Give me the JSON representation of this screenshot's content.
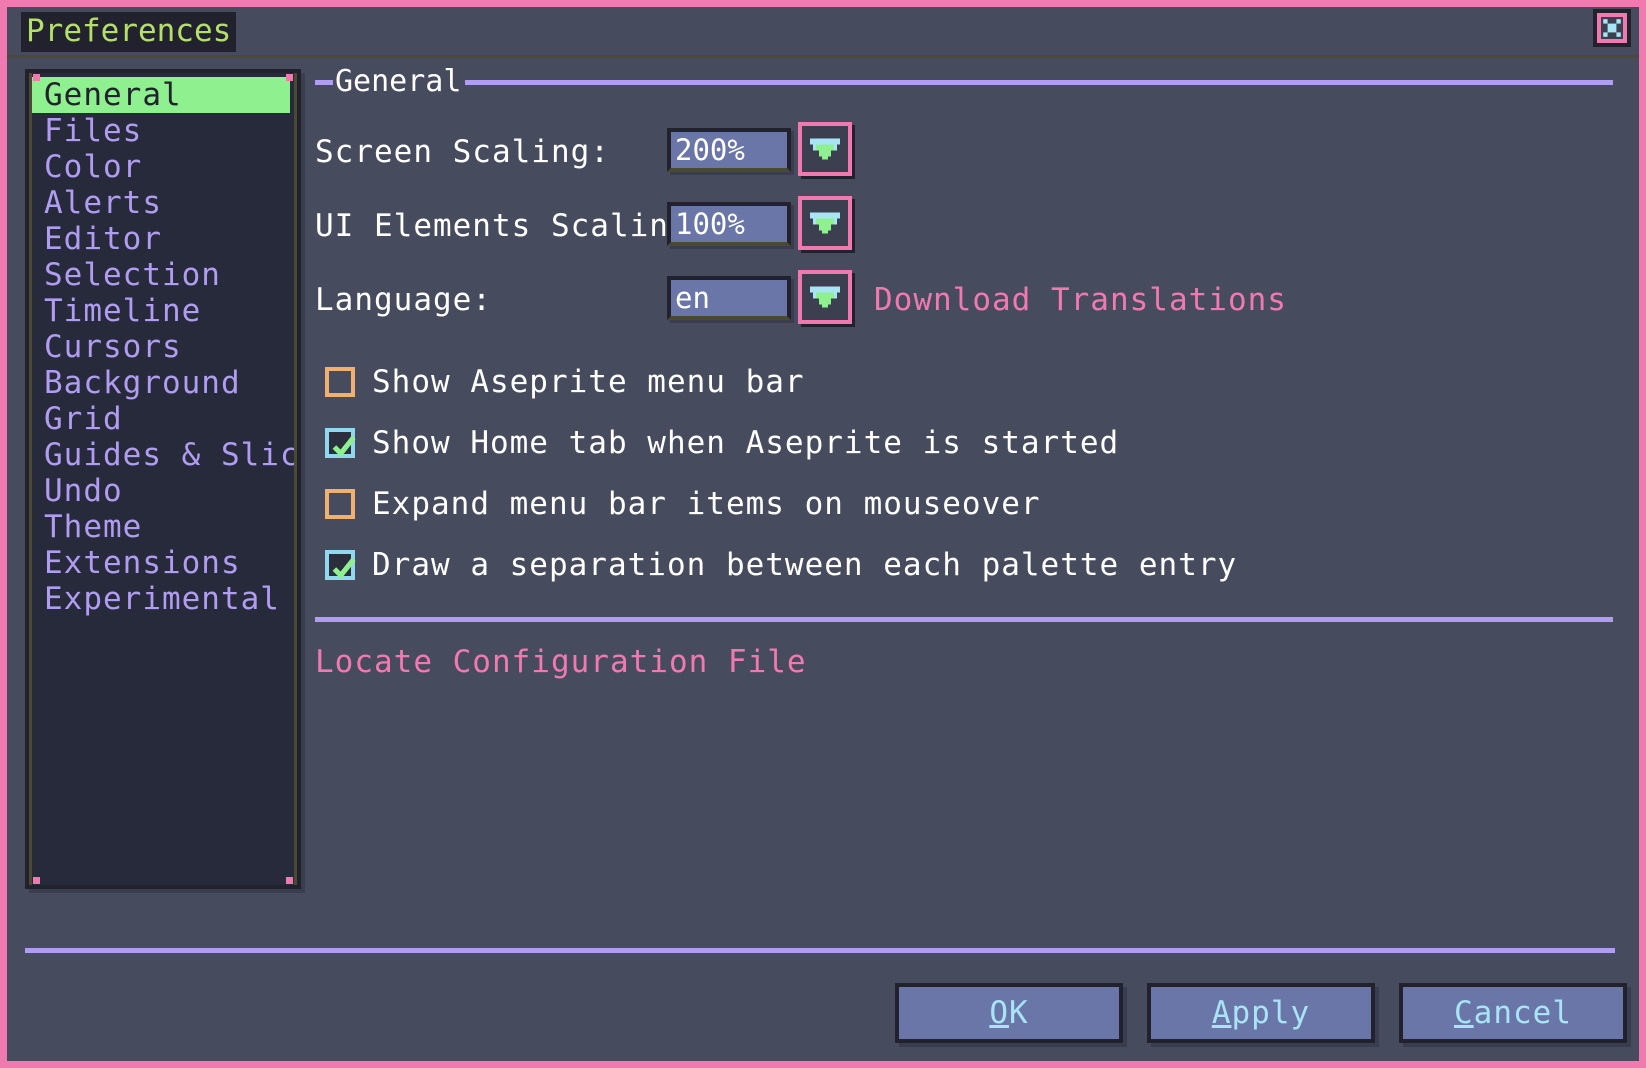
{
  "window": {
    "title": "Preferences",
    "close_icon": "close-x-icon"
  },
  "colors": {
    "window_border": "#f07ab0",
    "window_bg": "#474b5e",
    "panel_dark": "#272a3a",
    "selected_item_bg": "#8ef08e",
    "list_item_text": "#b09cf0",
    "link_pink": "#f07ab0",
    "rule_purple": "#b09cf0",
    "title_green": "#b4e06a",
    "checkbox_off": "#f0b070",
    "checkbox_on": "#90d8f0",
    "checkmark_green": "#8ef08e",
    "field_bg": "#6a76a8",
    "button_text": "#a8e4f4"
  },
  "sidebar": {
    "items": [
      {
        "label": "General",
        "selected": true
      },
      {
        "label": "Files",
        "selected": false
      },
      {
        "label": "Color",
        "selected": false
      },
      {
        "label": "Alerts",
        "selected": false
      },
      {
        "label": "Editor",
        "selected": false
      },
      {
        "label": "Selection",
        "selected": false
      },
      {
        "label": "Timeline",
        "selected": false
      },
      {
        "label": "Cursors",
        "selected": false
      },
      {
        "label": "Background",
        "selected": false
      },
      {
        "label": "Grid",
        "selected": false
      },
      {
        "label": "Guides & Slices",
        "selected": false
      },
      {
        "label": "Undo",
        "selected": false
      },
      {
        "label": "Theme",
        "selected": false
      },
      {
        "label": "Extensions",
        "selected": false
      },
      {
        "label": "Experimental",
        "selected": false
      }
    ]
  },
  "main": {
    "group_title": "General",
    "fields": [
      {
        "label": "Screen Scaling:",
        "value": "200%"
      },
      {
        "label": "UI Elements Scaling:",
        "value": "100%"
      },
      {
        "label": "Language:",
        "value": "en"
      }
    ],
    "download_translations_label": "Download Translations",
    "checkboxes": [
      {
        "label": "Show Aseprite menu bar",
        "checked": false
      },
      {
        "label": "Show Home tab when Aseprite is started",
        "checked": true
      },
      {
        "label": "Expand menu bar items on mouseover",
        "checked": false
      },
      {
        "label": "Draw a separation between each palette entry",
        "checked": true
      }
    ],
    "locate_config_label": "Locate Configuration File"
  },
  "footer": {
    "buttons": [
      {
        "mnemonic": "O",
        "rest": "K"
      },
      {
        "mnemonic": "A",
        "rest": "pply"
      },
      {
        "mnemonic": "C",
        "rest": "ancel"
      }
    ]
  }
}
